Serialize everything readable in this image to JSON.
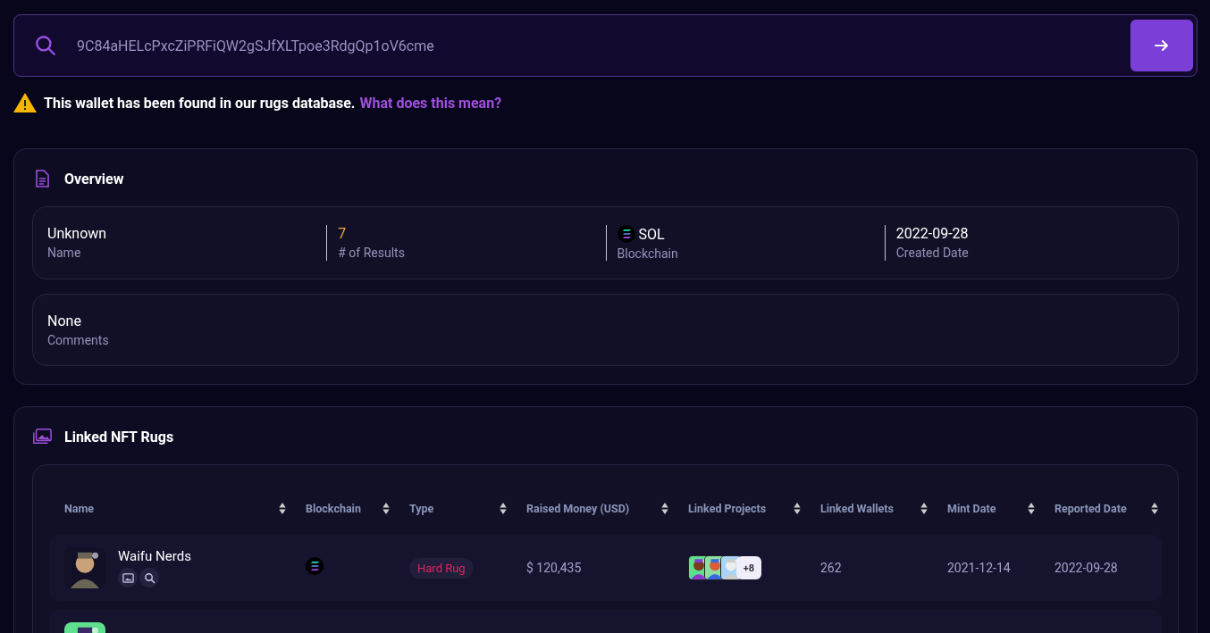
{
  "search": {
    "value": "9C84aHELcPxcZiPRFiQW2gSJfXLTpoe3RdgQp1oV6cme"
  },
  "warning": {
    "text": "This wallet has been found in our rugs database.",
    "link": "What does this mean?"
  },
  "overview": {
    "title": "Overview",
    "stats": [
      {
        "kind": "text",
        "value": "Unknown",
        "label": "Name"
      },
      {
        "kind": "count",
        "value": "7",
        "label": "# of Results"
      },
      {
        "kind": "chain",
        "value": "SOL",
        "label": "Blockchain"
      },
      {
        "kind": "text",
        "value": "2022-09-28",
        "label": "Created Date"
      }
    ],
    "comments": {
      "value": "None",
      "label": "Comments"
    }
  },
  "linked_rugs": {
    "title": "Linked NFT Rugs",
    "columns": [
      "Name",
      "Blockchain",
      "Type",
      "Raised Money (USD)",
      "Linked Projects",
      "Linked Wallets",
      "Mint Date",
      "Reported Date"
    ],
    "rows": [
      {
        "kind": "full",
        "name": "Waifu Nerds",
        "type": "Hard Rug",
        "raised": "$ 120,435",
        "projects_more": "+8",
        "wallets": "262",
        "mint_date": "2021-12-14",
        "reported_date": "2022-09-28"
      },
      {
        "kind": "partial"
      }
    ]
  }
}
